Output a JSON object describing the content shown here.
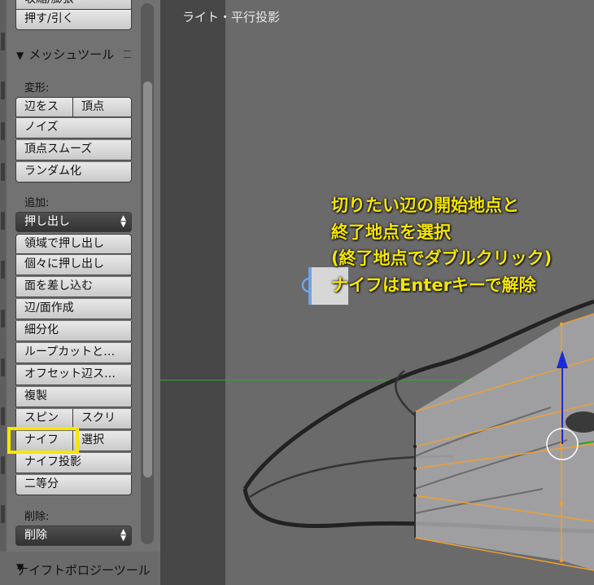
{
  "panel": {
    "top_buttons": [
      "収縮/膨張",
      "押す/引く"
    ],
    "mesh_tools_header": "メッシュツール",
    "transform": {
      "label": "変形:",
      "row": [
        "辺をス",
        "頂点"
      ],
      "buttons": [
        "ノイズ",
        "頂点スムーズ",
        "ランダム化"
      ]
    },
    "add": {
      "label": "追加:",
      "extrude_select": "押し出し",
      "buttons": [
        "領域で押し出し",
        "個々に押し出し",
        "面を差し込む",
        "辺/面作成",
        "細分化",
        "ループカットと…",
        "オフセット辺ス…",
        "複製"
      ],
      "spin_row": [
        "スピン",
        "スクリ"
      ],
      "knife_row": [
        "ナイフ",
        "選択"
      ],
      "knife_project": "ナイフ投影",
      "bisect": "二等分"
    },
    "delete": {
      "label": "削除:",
      "select": "削除"
    },
    "knife_topology": "ナイフトポロジーツール"
  },
  "viewport": {
    "title": "ライト・平行投影"
  },
  "annotation": {
    "lines": [
      "切りたい辺の開始地点と",
      "終了地点を選択",
      "(終了地点でダブルクリック)",
      "ナイフはEnterキーで解除"
    ]
  },
  "colors": {
    "highlight": "#f6e600",
    "selection_edges": "#f0a030",
    "manipulator_arrow": "#1a2bd6"
  }
}
